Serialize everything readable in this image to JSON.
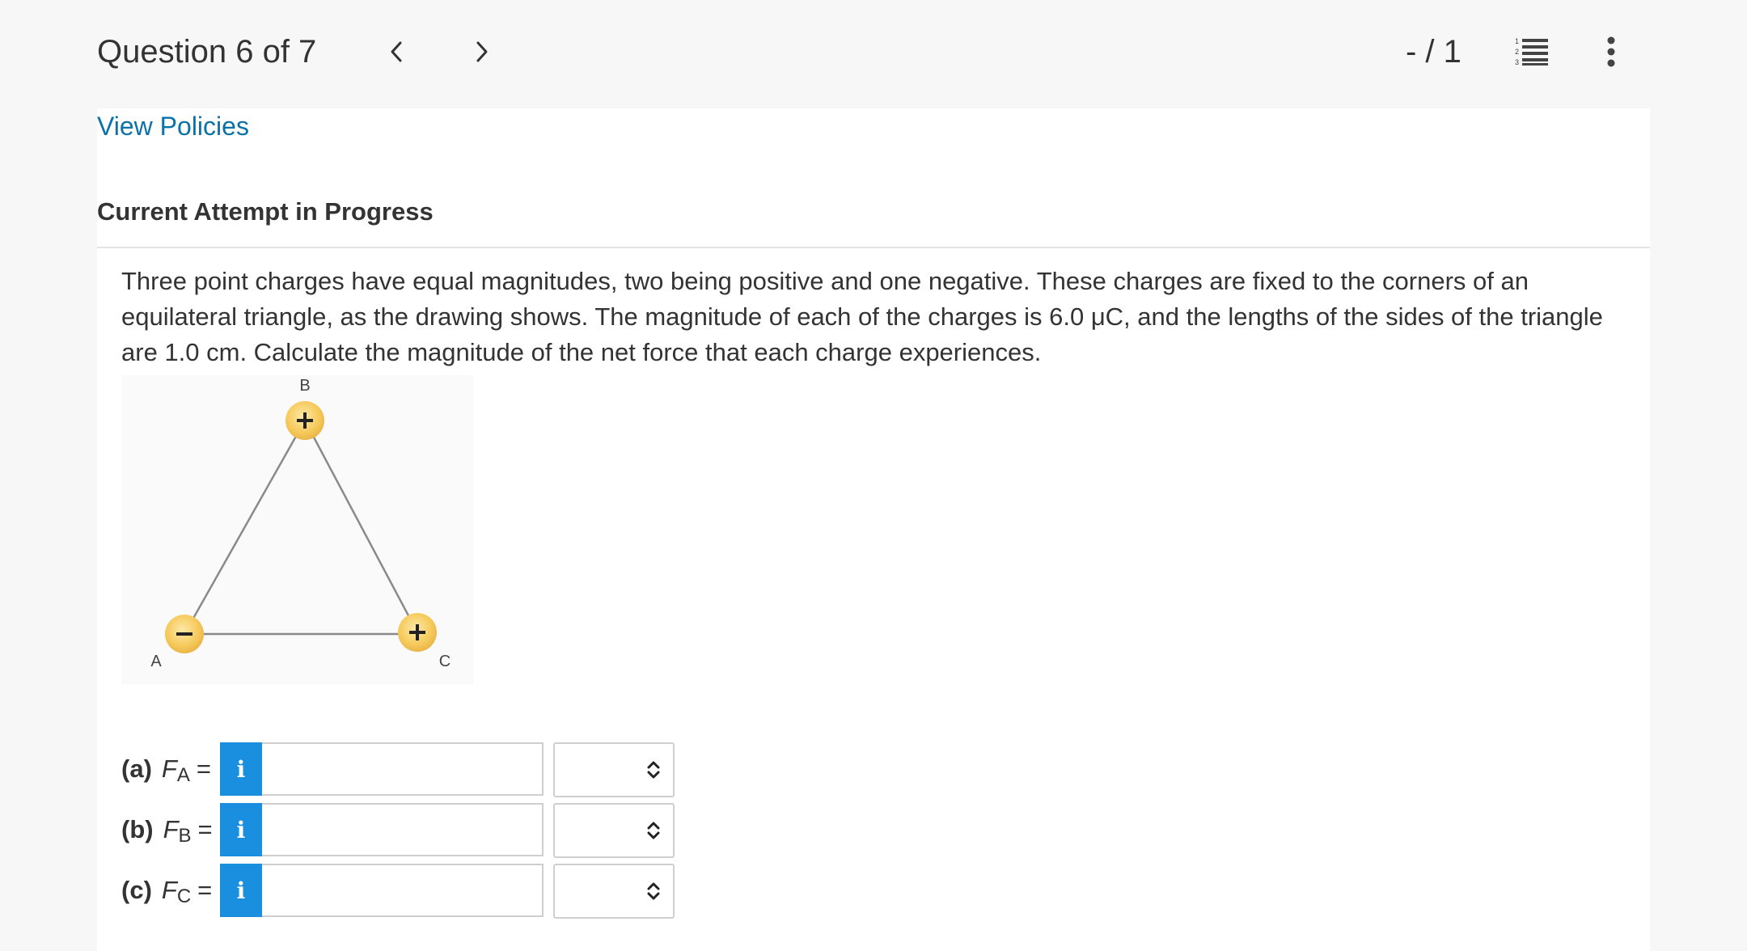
{
  "header": {
    "question_title": "Question 6 of 7",
    "prev_icon": "chevron-left-icon",
    "next_icon": "chevron-right-icon",
    "score": "- / 1",
    "list_icon": "numbered-list-icon",
    "more_icon": "more-vertical-icon"
  },
  "main": {
    "policies_link": "View Policies",
    "attempt_heading": "Current Attempt in Progress",
    "problem_text": "Three point charges have equal magnitudes, two being positive and one negative. These charges are fixed to the corners of an equilateral triangle, as the drawing shows. The magnitude of each of the charges is 6.0 μC, and the lengths of the sides of the triangle are 1.0 cm. Calculate the magnitude of the net force that each charge experiences.",
    "figure": {
      "labels": {
        "a": "A",
        "b": "B",
        "c": "C"
      },
      "charges": {
        "a": "−",
        "b": "+",
        "c": "+"
      }
    },
    "answers": [
      {
        "part": "(a)",
        "var": "F",
        "sub": "A",
        "eq": "=",
        "info": "i",
        "value": "",
        "unit": ""
      },
      {
        "part": "(b)",
        "var": "F",
        "sub": "B",
        "eq": "=",
        "info": "i",
        "value": "",
        "unit": ""
      },
      {
        "part": "(c)",
        "var": "F",
        "sub": "C",
        "eq": "=",
        "info": "i",
        "value": "",
        "unit": ""
      }
    ]
  },
  "colors": {
    "link": "#0b72a8",
    "info_button": "#1a8fe0",
    "charge_fill": "#f6c95a"
  }
}
